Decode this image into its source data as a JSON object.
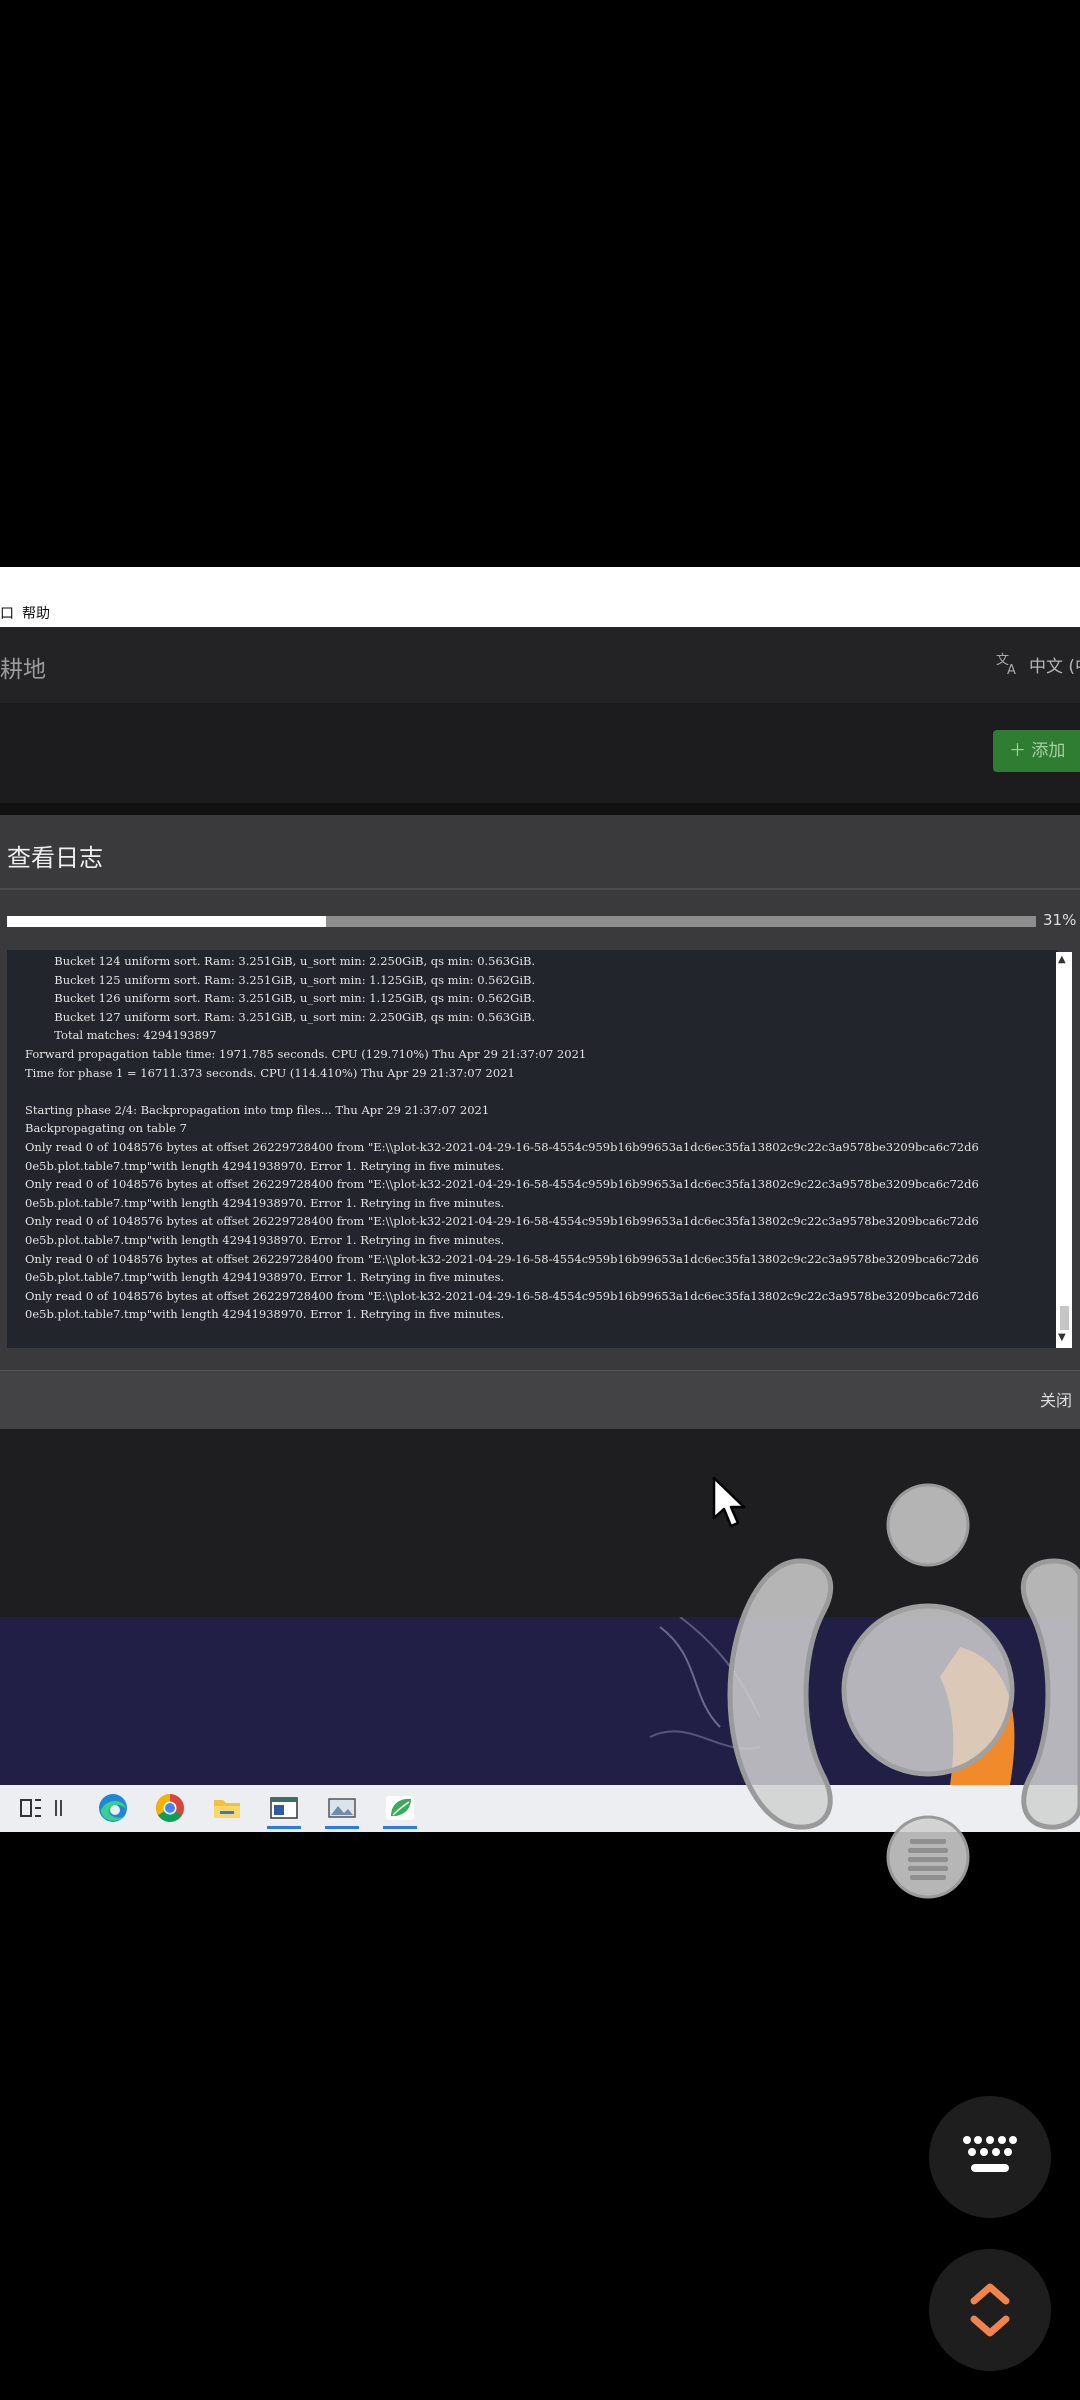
{
  "window": {
    "menu_items": [
      "口",
      "帮助"
    ],
    "app_title": "耕地",
    "language_label": "中文 (中",
    "add_button_label": "添加"
  },
  "dialog": {
    "title": "查看日志",
    "progress_percent": 31,
    "progress_label": "31%",
    "close_label": "关闭",
    "log_lines": [
      "        Bucket 124 uniform sort. Ram: 3.251GiB, u_sort min: 2.250GiB, qs min: 0.563GiB.",
      "        Bucket 125 uniform sort. Ram: 3.251GiB, u_sort min: 1.125GiB, qs min: 0.562GiB.",
      "        Bucket 126 uniform sort. Ram: 3.251GiB, u_sort min: 1.125GiB, qs min: 0.562GiB.",
      "        Bucket 127 uniform sort. Ram: 3.251GiB, u_sort min: 2.250GiB, qs min: 0.563GiB.",
      "        Total matches: 4294193897",
      "Forward propagation table time: 1971.785 seconds. CPU (129.710%) Thu Apr 29 21:37:07 2021",
      "Time for phase 1 = 16711.373 seconds. CPU (114.410%) Thu Apr 29 21:37:07 2021",
      "",
      "Starting phase 2/4: Backpropagation into tmp files... Thu Apr 29 21:37:07 2021",
      "Backpropagating on table 7",
      "Only read 0 of 1048576 bytes at offset 26229728400 from \"E:\\\\plot-k32-2021-04-29-16-58-4554c959b16b99653a1dc6ec35fa13802c9c22c3a9578be3209bca6c72d6",
      "0e5b.plot.table7.tmp\"with length 42941938970. Error 1. Retrying in five minutes.",
      "Only read 0 of 1048576 bytes at offset 26229728400 from \"E:\\\\plot-k32-2021-04-29-16-58-4554c959b16b99653a1dc6ec35fa13802c9c22c3a9578be3209bca6c72d6",
      "0e5b.plot.table7.tmp\"with length 42941938970. Error 1. Retrying in five minutes.",
      "Only read 0 of 1048576 bytes at offset 26229728400 from \"E:\\\\plot-k32-2021-04-29-16-58-4554c959b16b99653a1dc6ec35fa13802c9c22c3a9578be3209bca6c72d6",
      "0e5b.plot.table7.tmp\"with length 42941938970. Error 1. Retrying in five minutes.",
      "Only read 0 of 1048576 bytes at offset 26229728400 from \"E:\\\\plot-k32-2021-04-29-16-58-4554c959b16b99653a1dc6ec35fa13802c9c22c3a9578be3209bca6c72d6",
      "0e5b.plot.table7.tmp\"with length 42941938970. Error 1. Retrying in five minutes.",
      "Only read 0 of 1048576 bytes at offset 26229728400 from \"E:\\\\plot-k32-2021-04-29-16-58-4554c959b16b99653a1dc6ec35fa13802c9c22c3a9578be3209bca6c72d6",
      "0e5b.plot.table7.tmp\"with length 42941938970. Error 1. Retrying in five minutes."
    ]
  },
  "taskbar": {
    "icons": [
      "task-view-icon",
      "separator-icon",
      "edge-icon",
      "chrome-icon",
      "file-explorer-icon",
      "terminal-window-icon",
      "photos-icon",
      "chia-leaf-icon"
    ]
  },
  "overlay": {
    "icons": [
      "small-circle-button-icon",
      "left-arc-button-icon",
      "right-arc-button-icon",
      "center-joystick-icon",
      "menu-lines-icon",
      "keyboard-icon",
      "expand-collapse-arrows-icon"
    ]
  },
  "colors": {
    "accent_green": "#2f7d32",
    "progress_fill": "#ffffff",
    "taskbar_active": "#2c7be5",
    "arrow_orange": "#f0844c"
  }
}
